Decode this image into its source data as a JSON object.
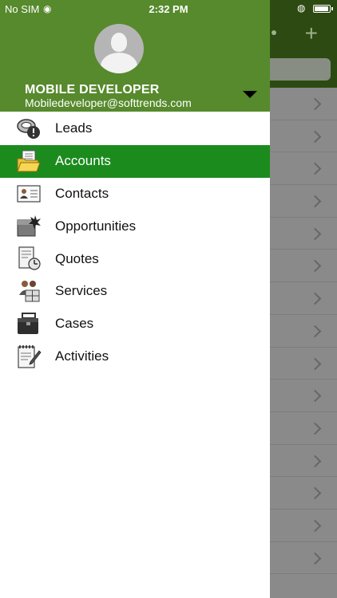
{
  "status_bar": {
    "carrier": "No SIM",
    "time": "2:32 PM"
  },
  "background": {
    "plus_label": "+"
  },
  "profile": {
    "name": "MOBILE DEVELOPER",
    "email": "Mobiledeveloper@softtrends.com"
  },
  "menu": {
    "active_index": 1,
    "items": [
      {
        "label": "Leads",
        "icon": "leads-icon"
      },
      {
        "label": "Accounts",
        "icon": "accounts-folder-icon"
      },
      {
        "label": "Contacts",
        "icon": "contacts-card-icon"
      },
      {
        "label": "Opportunities",
        "icon": "opportunities-icon"
      },
      {
        "label": "Quotes",
        "icon": "quotes-icon"
      },
      {
        "label": "Services",
        "icon": "services-icon"
      },
      {
        "label": "Cases",
        "icon": "cases-briefcase-icon"
      },
      {
        "label": "Activities",
        "icon": "activities-notepad-icon"
      }
    ]
  },
  "colors": {
    "profile_bg": "#568a2c",
    "active_item": "#1c8b1e"
  }
}
